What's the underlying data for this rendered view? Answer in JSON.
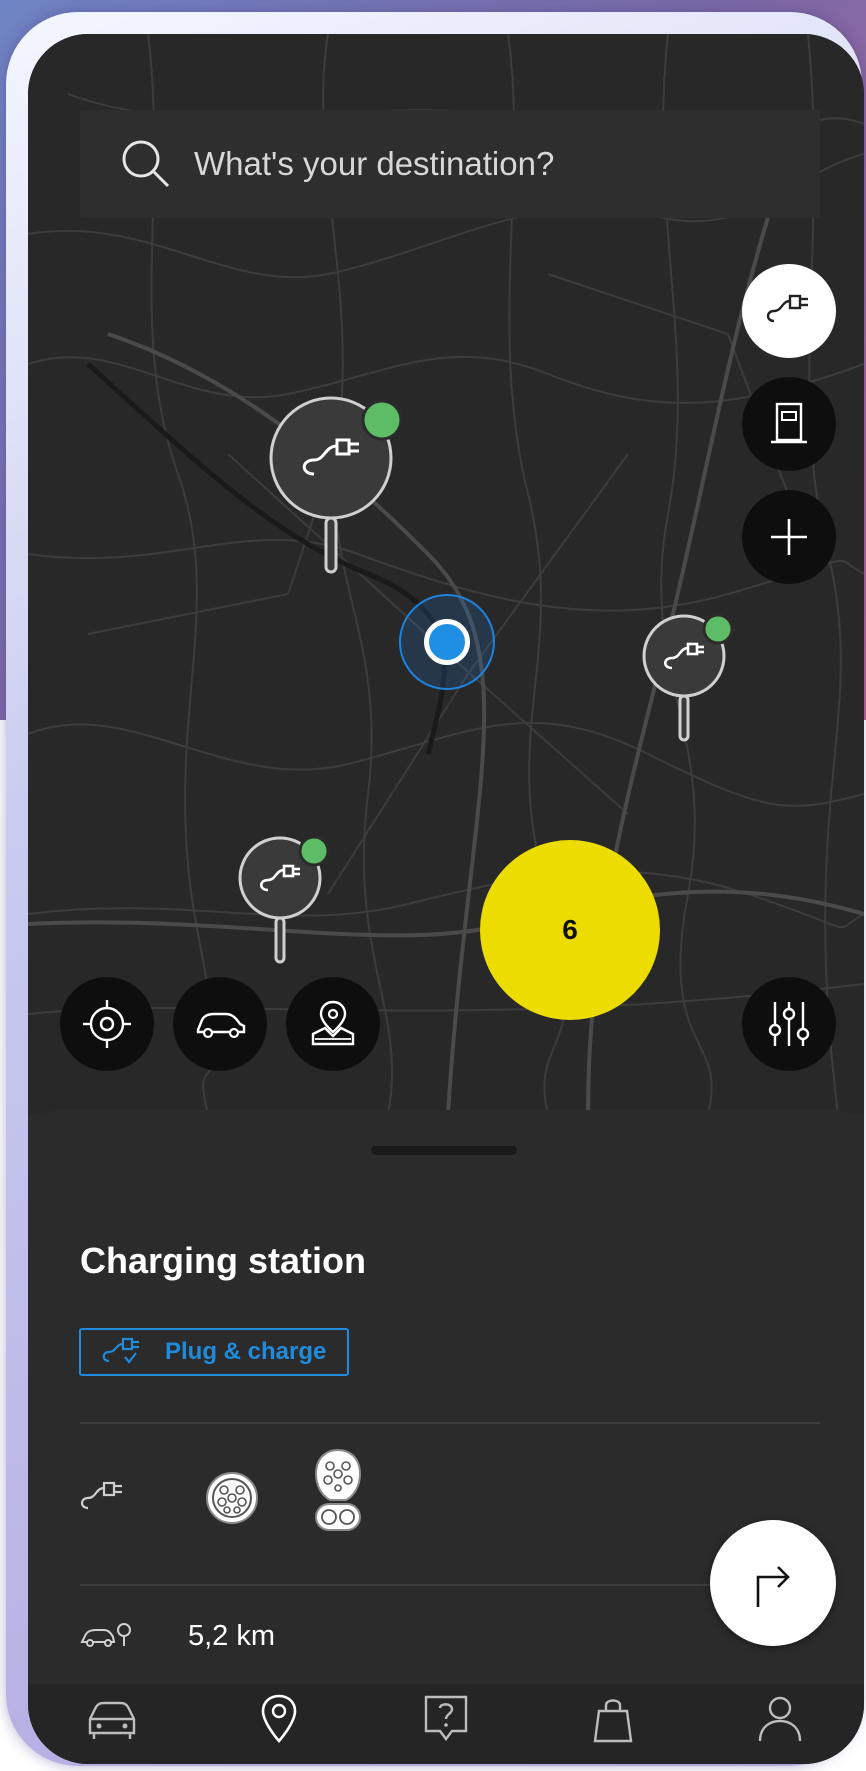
{
  "search": {
    "placeholder": "What's your destination?"
  },
  "map": {
    "cluster_count": "6",
    "controls_right": [
      "charging-filter",
      "fuel-station",
      "add"
    ],
    "controls_bottom_left": [
      "locate-me",
      "car",
      "map-layers"
    ],
    "filter_control": "sliders"
  },
  "sheet": {
    "title": "Charging station",
    "tag_label": "Plug & charge",
    "connectors": [
      "type2-connector",
      "ccs-connector"
    ],
    "distance": "5,2 km"
  },
  "nav": {
    "items": [
      "car",
      "map-pin",
      "help",
      "shop",
      "profile"
    ],
    "active": "map-pin"
  },
  "colors": {
    "accent_blue": "#1e8bdc",
    "cluster_yellow": "#ecdc00",
    "available_green": "#5dbd66",
    "map_bg": "#282828"
  }
}
